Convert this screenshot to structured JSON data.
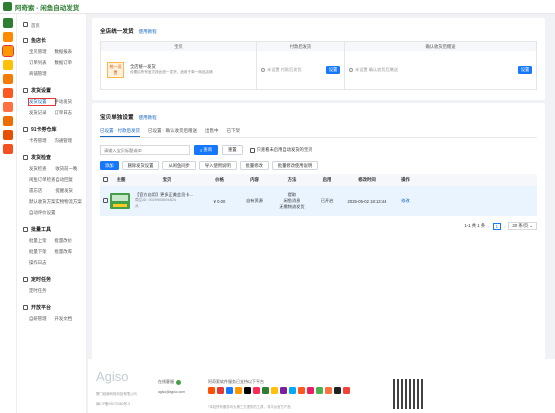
{
  "app": {
    "title": "阿奇索 - 闲鱼自动发货"
  },
  "rail": {
    "icons": [
      "logo-icon",
      "dashboard-icon",
      "store-icon",
      "shop-icon",
      "goods-icon",
      "delivery-icon",
      "chart-icon",
      "tool-icon",
      "time-icon",
      "platform-icon"
    ],
    "colors": [
      "#2e7d32",
      "#ff8a00",
      "#ff9800",
      "#ffc107",
      "#f57c00",
      "#ff5722",
      "#ff7043",
      "#ef6c00",
      "#e65100",
      "#f4511e"
    ]
  },
  "nav": {
    "home": "首页",
    "sections": [
      {
        "title": "鱼店长",
        "icon": "fish-icon",
        "links": [
          "宝贝管理",
          "数据报表",
          "订单列表",
          "数据订单",
          "商铺管理"
        ]
      },
      {
        "title": "发货设置",
        "icon": "delivery-icon",
        "links": [
          "发货设置",
          "手动发货",
          "发货记录",
          "订单日志"
        ],
        "active": "发货设置"
      },
      {
        "title": "91卡券仓库",
        "icon": "card-icon",
        "links": [
          "卡券管理",
          "沟通管理"
        ]
      },
      {
        "title": "发货检查",
        "icon": "check-icon",
        "links": [
          "发货检查",
          "收货前一晚",
          "闲鱼订单检查",
          "自动回复",
          "遗忘店",
          "提醒发货",
          "默认收货方案",
          "实物物流方案",
          "自动评价设置"
        ]
      },
      {
        "title": "批量工具",
        "icon": "tools-icon",
        "links": [
          "批量上架",
          "批量改价",
          "批量下架",
          "批量改库",
          "操作日志"
        ]
      },
      {
        "title": "定时任务",
        "icon": "timer-icon",
        "links": [
          "定时任务"
        ]
      },
      {
        "title": "开放平台",
        "icon": "platform-icon",
        "links": [
          "自研管理",
          "开发文档"
        ]
      }
    ]
  },
  "shop_card": {
    "title": "全店统一发货",
    "help": "使用教程",
    "headers": [
      "宝贝",
      "付款后发货",
      "确认收货后赠送"
    ],
    "badge": "统一设置",
    "desc_title": "全店统一发货",
    "desc": "设置后所有宝贝按此统一发货，适用于单一商品店铺",
    "opt1": "未设置 付款后发货",
    "opt2": "未设置 确认收货后赠送",
    "set_btn": "设置"
  },
  "item_card": {
    "title": "宝贝单独设置",
    "help": "使用教程",
    "tabs": [
      "已设置 · 付款后发货",
      "已设置 · 确认收货后赠送",
      "出售中",
      "已下架"
    ],
    "search_placeholder": "请输入宝贝标题或ID",
    "query_btn": "查询",
    "reset_btn": "重置",
    "checkbox_label": "只查看未启用自动发货的宝贝",
    "actions": [
      "添加",
      "删除发货设置",
      "从闲鱼同步",
      "导入使用说明",
      "批量修改",
      "批量修改使用说明"
    ],
    "columns": [
      "",
      "主图",
      "宝贝",
      "价格",
      "内容",
      "方法",
      "启用",
      "修改时间",
      "操作"
    ],
    "row": {
      "title": "【官方自用】更多正美会员卡...",
      "id": "商品ID: 9029905894824",
      "sub": "从",
      "price": "¥ 0.00",
      "content": "自有资源",
      "method": "提取\n闲鱼消息\n无需物流发货",
      "status": "已开启",
      "time": "2025-05-02 18:13:44",
      "op": "修改"
    },
    "pager": {
      "range": "1-1 共 1 条",
      "page": "1",
      "size": "20 条/页"
    }
  },
  "footer": {
    "brand": "Agiso",
    "company": "厦门纸扇网络科技有限公司",
    "icp": "闽ICP备09070360号-3",
    "wechat": "在线客服",
    "email": "agiso@agiso.com",
    "platform_title": "阿奇索软件服务已支持以下平台",
    "note": "*本站所有服务均为第三方提供的工具，非平台官方产品",
    "platform_colors": [
      "#ff5000",
      "#e53935",
      "#1677ff",
      "#ff9800",
      "#000000",
      "#fe2c55",
      "#2e7d32",
      "#ffc107",
      "#7b1fa2",
      "#03a9f4",
      "#ff5722",
      "#e91e63",
      "#4caf50",
      "#ff7043",
      "#212121",
      "#f44336"
    ]
  }
}
